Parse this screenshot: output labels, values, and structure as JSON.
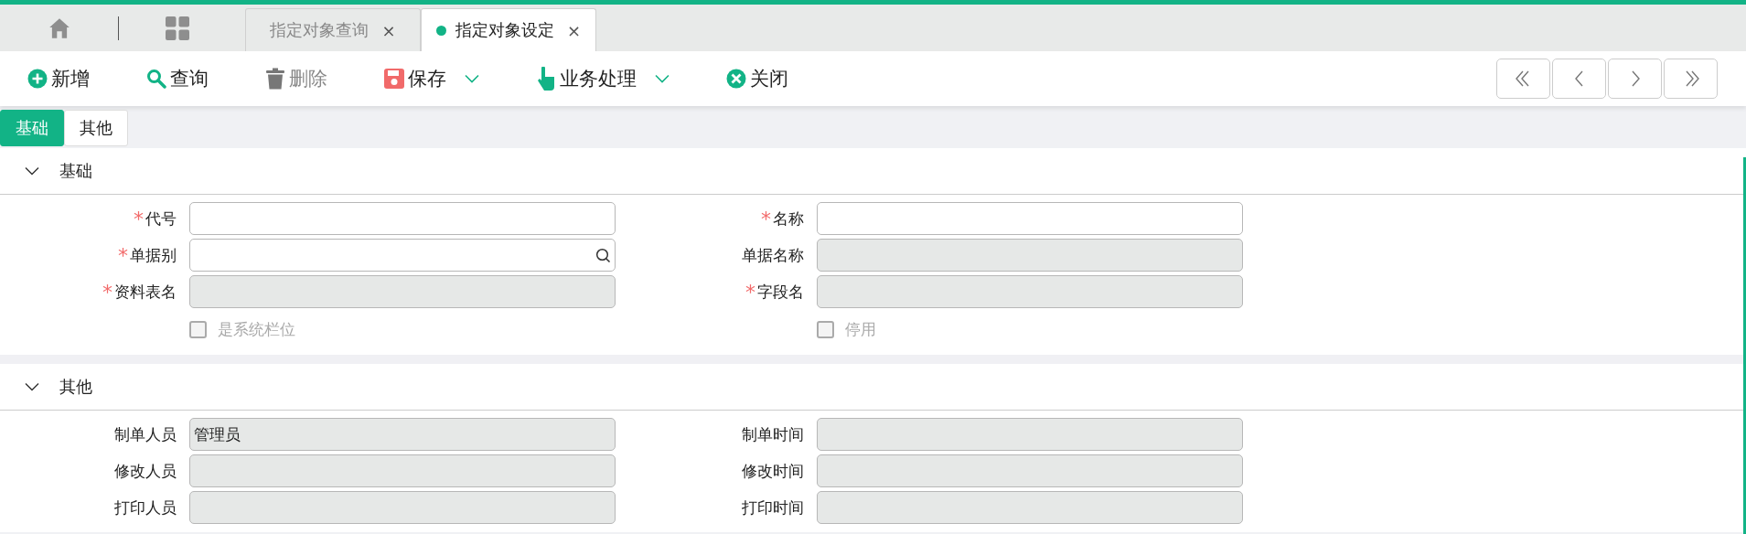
{
  "tabs": [
    {
      "label": "指定对象查询",
      "selected": false,
      "close": "×"
    },
    {
      "label": "指定对象设定",
      "selected": true,
      "close": "×"
    }
  ],
  "toolbar": [
    {
      "label": "新增",
      "kind": "add",
      "dropdown": false,
      "disabled": false
    },
    {
      "label": "查询",
      "kind": "search",
      "dropdown": false,
      "disabled": false
    },
    {
      "label": "删除",
      "kind": "delete",
      "dropdown": false,
      "disabled": true
    },
    {
      "label": "保存",
      "kind": "save",
      "dropdown": true,
      "disabled": false
    },
    {
      "label": "业务处理",
      "kind": "process",
      "dropdown": true,
      "disabled": false
    },
    {
      "label": "关闭",
      "kind": "close",
      "dropdown": false,
      "disabled": false
    }
  ],
  "subtabs": [
    {
      "label": "基础",
      "selected": true
    },
    {
      "label": "其他",
      "selected": false
    }
  ],
  "sections": [
    {
      "title": "基础",
      "expanded": true,
      "fields": [
        {
          "label": "代号",
          "kind": "text",
          "mark": "*",
          "readonly": false
        },
        {
          "label": "名称",
          "kind": "text",
          "mark": "*",
          "readonly": false
        },
        {
          "label": "单据别",
          "kind": "lookup",
          "mark": "*",
          "readonly": false
        },
        {
          "label": "单据名称",
          "kind": "text",
          "readonly": true
        },
        {
          "label": "资料表名",
          "kind": "text",
          "mark": "*",
          "readonly": true
        },
        {
          "label": "字段名",
          "kind": "text",
          "mark": "*",
          "readonly": true
        },
        {
          "label": "是系统栏位",
          "kind": "checkbox",
          "checked": false,
          "disabled": true
        },
        {
          "label": "停用",
          "kind": "checkbox",
          "checked": false,
          "disabled": true
        }
      ]
    },
    {
      "title": "其他",
      "expanded": true,
      "fields": [
        {
          "label": "制单人员",
          "kind": "text",
          "readonly": true,
          "value": "管理员"
        },
        {
          "label": "制单时间",
          "kind": "text",
          "readonly": true
        },
        {
          "label": "修改人员",
          "kind": "text",
          "readonly": true
        },
        {
          "label": "修改时间",
          "kind": "text",
          "readonly": true
        },
        {
          "label": "打印人员",
          "kind": "text",
          "readonly": true
        },
        {
          "label": "打印时间",
          "kind": "text",
          "readonly": true
        }
      ]
    }
  ]
}
